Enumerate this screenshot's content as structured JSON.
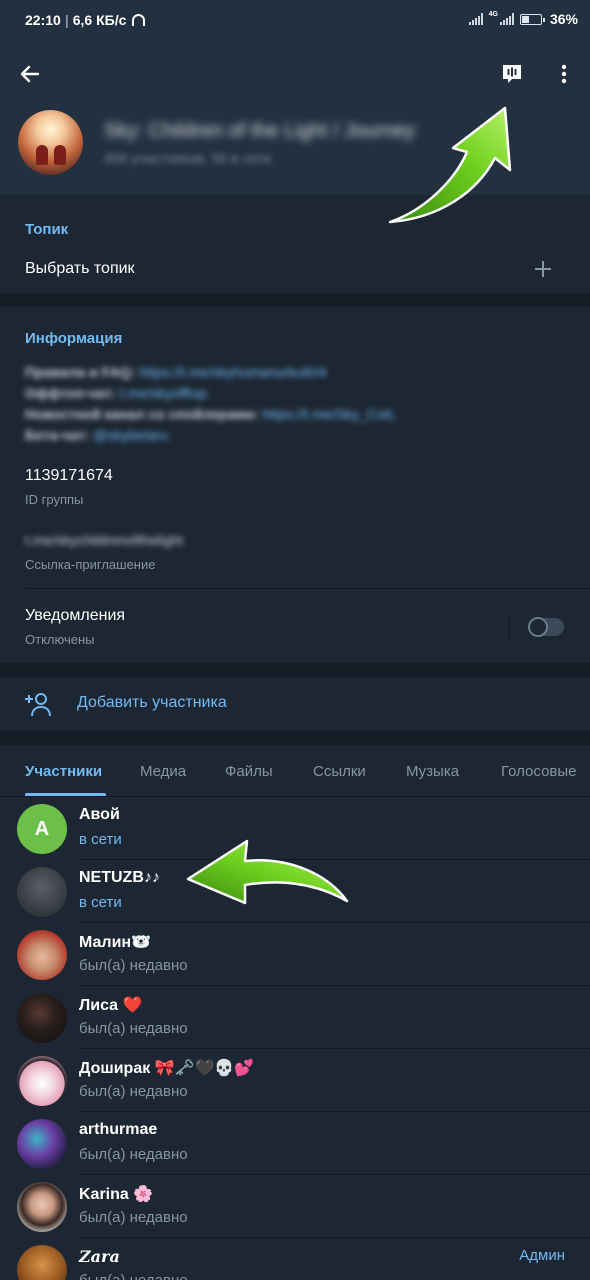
{
  "status_bar": {
    "time": "22:10",
    "speed": "6,6 КБ/с",
    "network": "4G",
    "battery": "36%"
  },
  "header": {
    "group_title": "Sky: Children of the Light / Journey",
    "group_subtitle": "456 участников, 56 в сети"
  },
  "topic": {
    "section_title": "Топик",
    "choose_label": "Выбрать топик"
  },
  "info": {
    "section_title": "Информация",
    "lines": [
      {
        "text": "Правила и FAQ:",
        "link": "https://t.me/skyhumanurkuth/4"
      },
      {
        "text": "Оффтоп-чат:",
        "link": "t.me/skyofftop"
      },
      {
        "text": "Новостной канал со спойлерами:",
        "link": "https://t.me/Sky_CotL"
      },
      {
        "text": "Бета-чат:",
        "link": "@skybetaru"
      }
    ],
    "group_id": "1139171674",
    "group_id_label": "ID группы",
    "invite_link": "t.me/skychildrenofthelight",
    "invite_label": "Ссылка-приглашение",
    "notifications_label": "Уведомления",
    "notifications_state": "Отключены"
  },
  "add_member_label": "Добавить участника",
  "tabs": [
    "Участники",
    "Медиа",
    "Файлы",
    "Ссылки",
    "Музыка",
    "Голосовые"
  ],
  "members": [
    {
      "name": "Авой",
      "status": "в сети",
      "online": true,
      "initial": "A",
      "avatar_color": "#6cc04a"
    },
    {
      "name": "NETUZB♪♪",
      "status": "в сети",
      "online": true,
      "avatar_color": "#3a3f48"
    },
    {
      "name": "Малин🐻‍❄️",
      "status": "был(а) недавно",
      "online": false,
      "avatar_color": "#c0573f"
    },
    {
      "name": "Лиса ❤️",
      "status": "был(а) недавно",
      "online": false,
      "avatar_color": "#1a1f22"
    },
    {
      "name": "Доширак 🎀🗝️🖤💀💕",
      "status": "был(а) недавно",
      "online": false,
      "avatar_color": "#e8b7c8"
    },
    {
      "name": "arthurmae",
      "status": "был(а) недавно",
      "online": false,
      "avatar_color": "#3a2f6a"
    },
    {
      "name": "Karina 🌸",
      "status": "был(а) недавно",
      "online": false,
      "avatar_color": "#d9d2cc"
    },
    {
      "name": "Zara",
      "status": "был(а) недавно",
      "online": false,
      "avatar_color": "#8a5a2a",
      "badge": "Админ"
    }
  ],
  "colors": {
    "accent": "#71baf3",
    "header_bg": "#233040",
    "page_bg": "#1d2733",
    "arrow": "#5fc21a"
  }
}
